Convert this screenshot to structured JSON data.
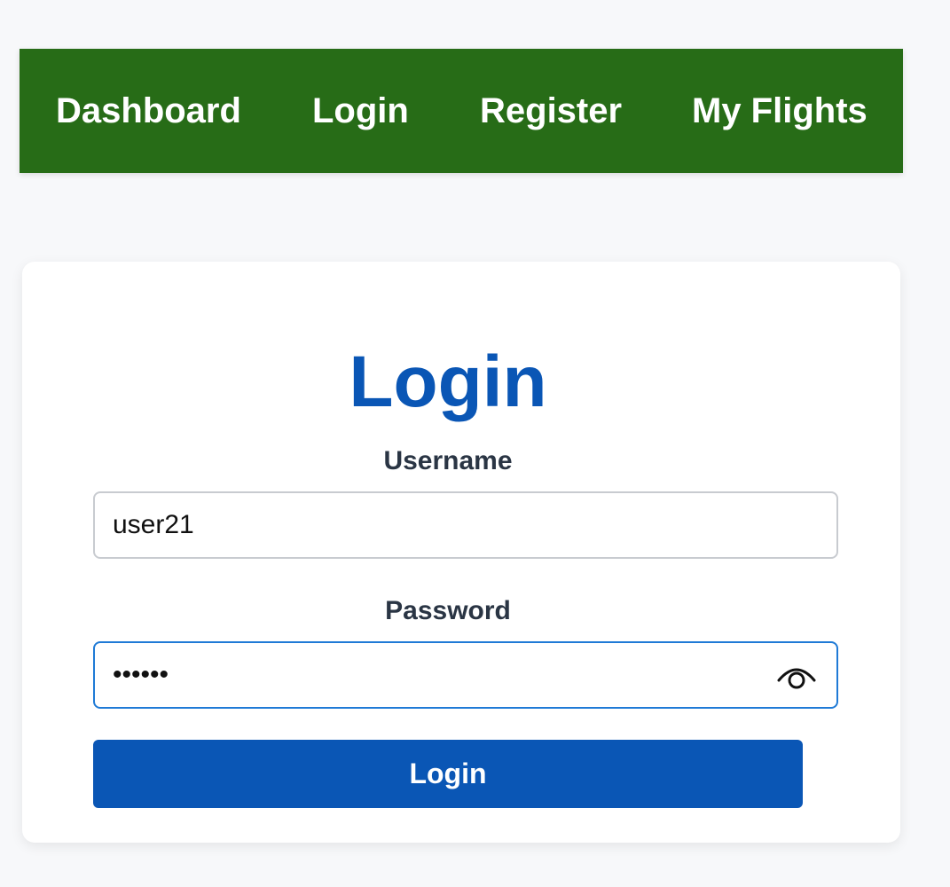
{
  "nav": {
    "items": [
      {
        "label": "Dashboard"
      },
      {
        "label": "Login"
      },
      {
        "label": "Register"
      },
      {
        "label": "My Flights"
      }
    ],
    "background": "#276c17"
  },
  "login_card": {
    "title": "Login",
    "username": {
      "label": "Username",
      "value": "user21"
    },
    "password": {
      "label": "Password",
      "value": "••••••",
      "toggle_icon": "eye-icon"
    },
    "submit_label": "Login",
    "accent_color": "#0a56b5"
  }
}
